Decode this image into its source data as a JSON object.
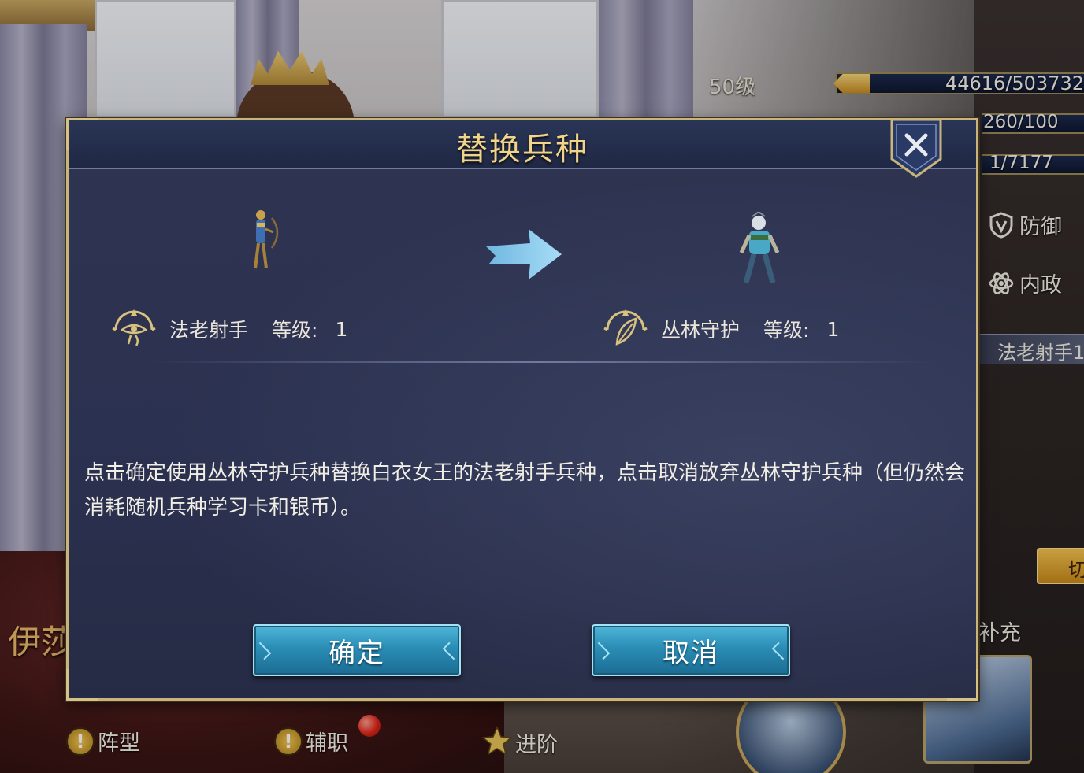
{
  "hud": {
    "level": "50级",
    "xp": "44616/503732",
    "resource_1": "260/100",
    "resource_2": "1/7177",
    "stats": [
      {
        "icon": "shield-icon",
        "label": "防御"
      },
      {
        "icon": "atom-icon",
        "label": "内政"
      }
    ],
    "unit_label": "法老射手1",
    "switch_label": "切",
    "refill_label": "补充"
  },
  "hero": {
    "name": "伊莎"
  },
  "bottom_tabs": [
    {
      "icon": "exclamation-icon",
      "label": "阵型"
    },
    {
      "icon": "exclamation-icon",
      "label": "辅职"
    },
    {
      "icon": "star-icon",
      "label": "进阶"
    }
  ],
  "modal": {
    "title": "替换兵种",
    "from_unit": {
      "name": "法老射手",
      "level_label": "等级:",
      "level": "1"
    },
    "to_unit": {
      "name": "丛林守护",
      "level_label": "等级:",
      "level": "1"
    },
    "message": "点击确定使用丛林守护兵种替换白衣女王的法老射手兵种，点击取消放弃丛林守护兵种（但仍然会消耗随机兵种学习卡和银币）。",
    "confirm_label": "确定",
    "cancel_label": "取消"
  },
  "colors": {
    "title_gold": "#f1d48a",
    "button_blue": "#2a8db5",
    "frame_gold": "#c9b47c",
    "panel_navy": "#2b3150"
  }
}
